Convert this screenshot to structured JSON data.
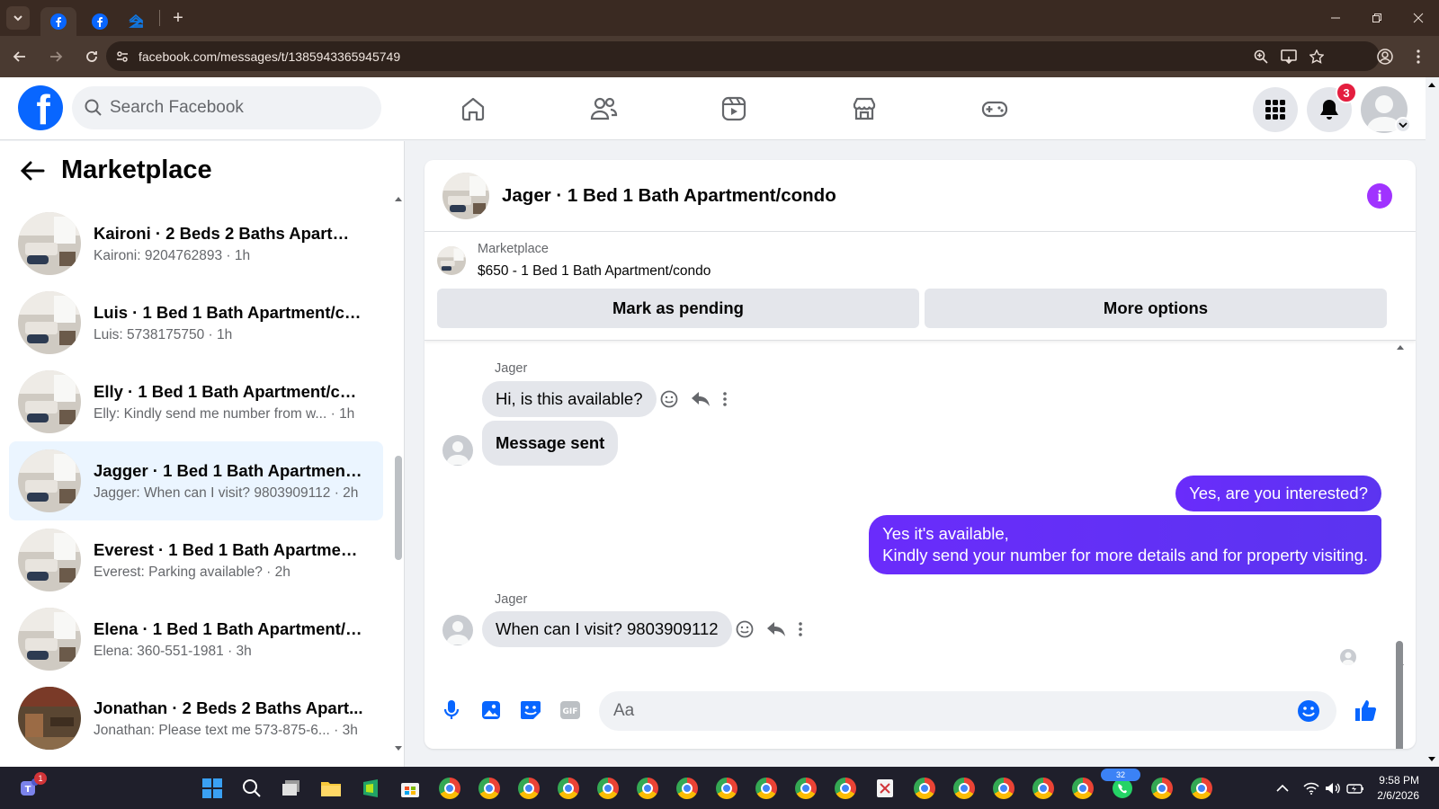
{
  "browser": {
    "url": "facebook.com/messages/t/1385943365945749",
    "tabs": [
      {
        "name": "facebook"
      },
      {
        "name": "facebook"
      },
      {
        "name": "zillow"
      }
    ]
  },
  "header": {
    "search_placeholder": "Search Facebook",
    "notification_count": "3"
  },
  "sidebar": {
    "title": "Marketplace",
    "conversations": [
      {
        "name": "Kaironi · 2 Beds 2 Baths Apartme...",
        "preview": "Kaironi: 9204762893 · 1h",
        "active": false
      },
      {
        "name": "Luis · 1 Bed 1 Bath Apartment/co...",
        "preview": "Luis: 5738175750 · 1h",
        "active": false
      },
      {
        "name": "Elly · 1 Bed 1 Bath Apartment/co...",
        "preview": "Elly: Kindly send me number from w... · 1h",
        "active": false
      },
      {
        "name": "Jagger · 1 Bed 1 Bath Apartment/...",
        "preview": "Jagger: When can I visit? 9803909112 · 2h",
        "active": true
      },
      {
        "name": "Everest · 1 Bed 1 Bath Apartment...",
        "preview": "Everest: Parking available? · 2h",
        "active": false
      },
      {
        "name": "Elena · 1 Bed 1 Bath Apartment/c...",
        "preview": "Elena: 360-551-1981 · 3h",
        "active": false
      },
      {
        "name": "Jonathan · 2 Beds 2 Baths Apart...",
        "preview": "Jonathan: Please text me 573-875-6... · 3h",
        "active": false
      }
    ]
  },
  "chat": {
    "title": "Jager · 1 Bed 1 Bath Apartment/condo",
    "listing": {
      "source": "Marketplace",
      "title": "$650 - 1 Bed 1 Bath Apartment/condo",
      "mark_pending": "Mark as pending",
      "more_options": "More options"
    },
    "messages": {
      "sender1": "Jager",
      "m1": "Hi, is this available?",
      "m2": "Message sent",
      "m3": "Yes, are you interested?",
      "m4_line1": "Yes it's available,",
      "m4_line2": "Kindly send your number for more details and for property visiting.",
      "sender2": "Jager",
      "m5": "When can I visit? 9803909112"
    },
    "composer_placeholder": "Aa"
  },
  "taskbar": {
    "time": "9:58 PM",
    "date": "2/6/2026",
    "whatsapp_badge": "32",
    "teams_badge": "1"
  },
  "colors": {
    "fb_blue": "#0866ff",
    "messenger_purple": "#6a2cfb",
    "active_row": "#ebf5ff"
  }
}
